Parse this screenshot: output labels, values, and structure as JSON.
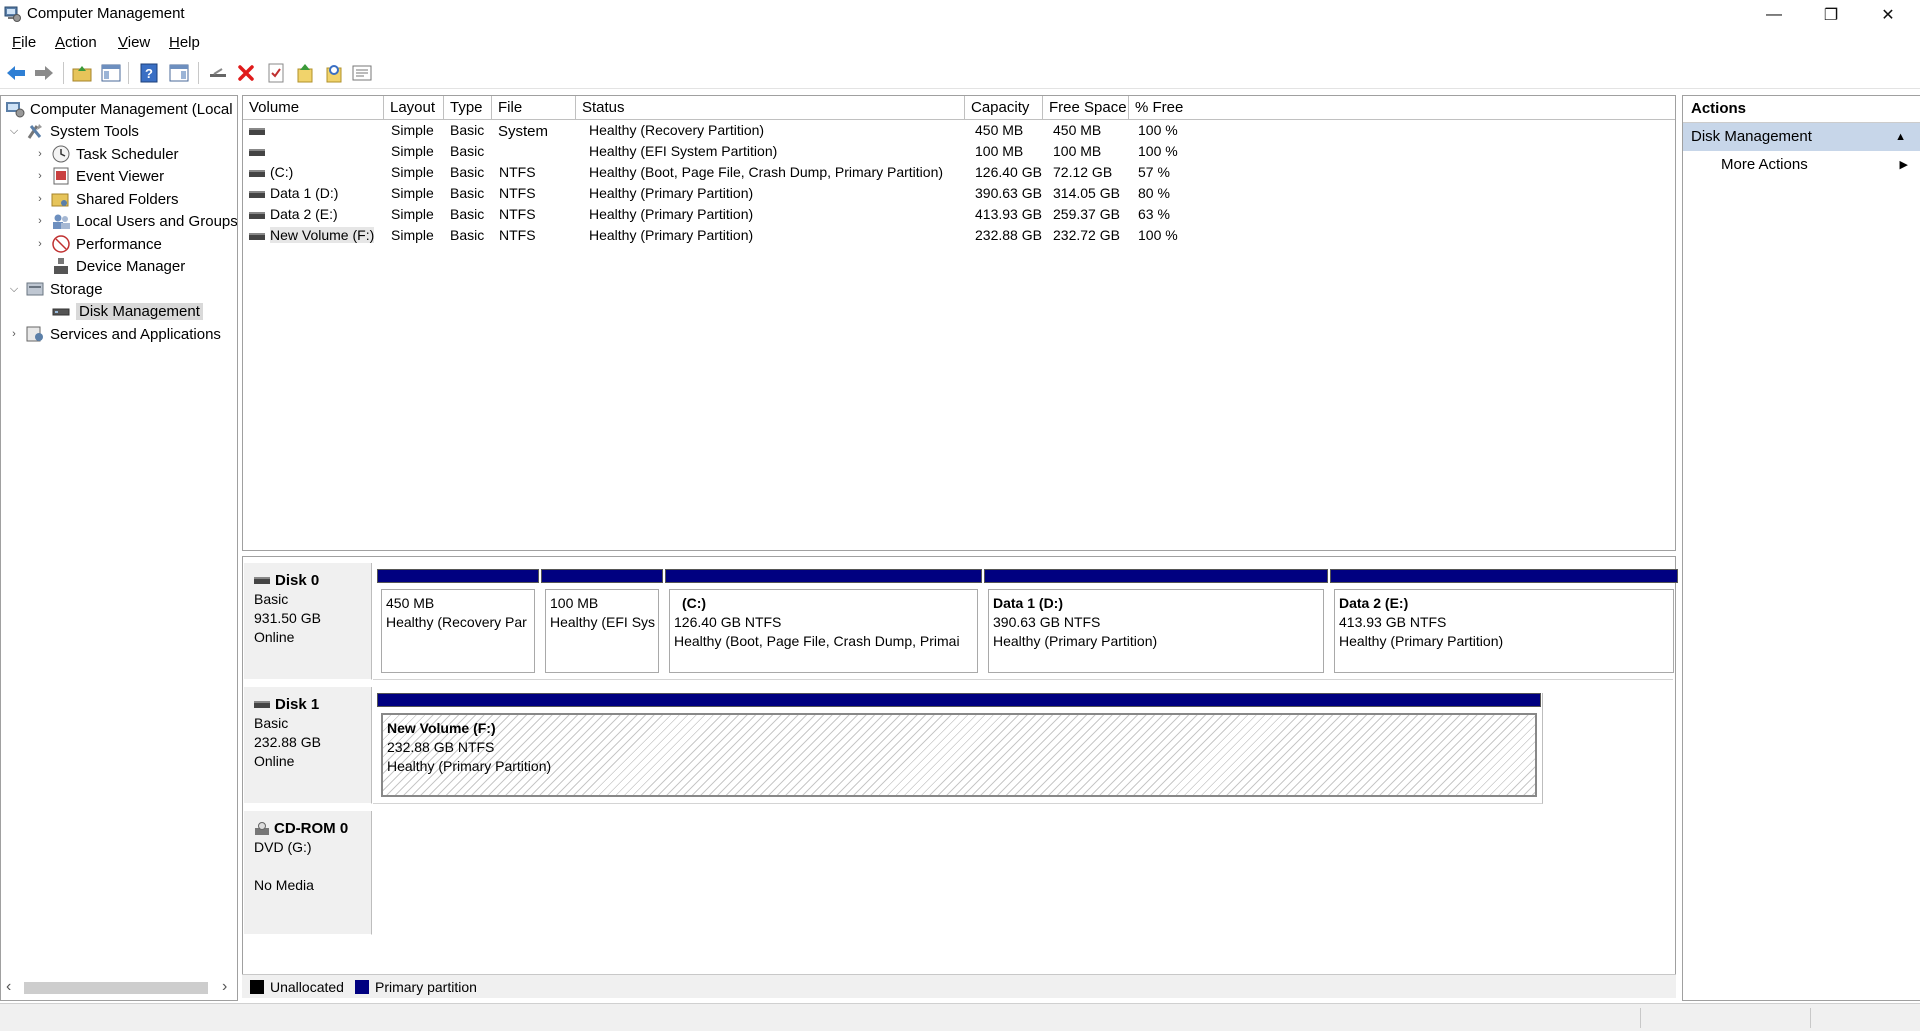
{
  "window": {
    "title": "Computer Management",
    "buttons": {
      "minimize": "—",
      "restore": "❐",
      "close": "✕"
    }
  },
  "menu": [
    "File",
    "Action",
    "View",
    "Help"
  ],
  "toolbar": {
    "icons": [
      "back-icon",
      "forward-icon",
      "up-icon",
      "show-hide-tree-icon",
      "help-icon",
      "properties-pane-icon",
      "connect-icon",
      "delete-icon",
      "check-icon",
      "refresh-icon",
      "search-icon",
      "list-icon"
    ],
    "delete_color": "#e01b1b"
  },
  "tree": {
    "root": "Computer Management (Local",
    "system_tools": "System Tools",
    "task_scheduler": "Task Scheduler",
    "event_viewer": "Event Viewer",
    "shared_folders": "Shared Folders",
    "local_users": "Local Users and Groups",
    "performance": "Performance",
    "device_manager": "Device Manager",
    "storage": "Storage",
    "disk_management": "Disk Management",
    "services": "Services and Applications"
  },
  "volumes": {
    "columns": [
      "Volume",
      "Layout",
      "Type",
      "File System",
      "Status",
      "Capacity",
      "Free Space",
      "% Free"
    ],
    "rows": [
      {
        "volume": "",
        "layout": "Simple",
        "type": "Basic",
        "fs": "",
        "status": "Healthy (Recovery Partition)",
        "capacity": "450 MB",
        "free": "450 MB",
        "pct": "100 %"
      },
      {
        "volume": "",
        "layout": "Simple",
        "type": "Basic",
        "fs": "",
        "status": "Healthy (EFI System Partition)",
        "capacity": "100 MB",
        "free": "100 MB",
        "pct": "100 %"
      },
      {
        "volume": "(C:)",
        "layout": "Simple",
        "type": "Basic",
        "fs": "NTFS",
        "status": "Healthy (Boot, Page File, Crash Dump, Primary Partition)",
        "capacity": "126.40 GB",
        "free": "72.12 GB",
        "pct": "57 %"
      },
      {
        "volume": "Data 1 (D:)",
        "layout": "Simple",
        "type": "Basic",
        "fs": "NTFS",
        "status": "Healthy (Primary Partition)",
        "capacity": "390.63 GB",
        "free": "314.05 GB",
        "pct": "80 %"
      },
      {
        "volume": "Data 2 (E:)",
        "layout": "Simple",
        "type": "Basic",
        "fs": "NTFS",
        "status": "Healthy (Primary Partition)",
        "capacity": "413.93 GB",
        "free": "259.37 GB",
        "pct": "63 %"
      },
      {
        "volume": "New Volume (F:)",
        "layout": "Simple",
        "type": "Basic",
        "fs": "NTFS",
        "status": "Healthy (Primary Partition)",
        "capacity": "232.88 GB",
        "free": "232.72 GB",
        "pct": "100 %"
      }
    ]
  },
  "disks": {
    "disk0": {
      "name": "Disk 0",
      "type": "Basic",
      "size": "931.50 GB",
      "state": "Online",
      "parts": [
        {
          "title": "",
          "size": "450 MB",
          "status": "Healthy (Recovery Par"
        },
        {
          "title": "",
          "size": "100 MB",
          "status": "Healthy (EFI Sys"
        },
        {
          "title": "(C:)",
          "size": "126.40 GB NTFS",
          "status": "Healthy (Boot, Page File, Crash Dump, Primai"
        },
        {
          "title": "Data 1  (D:)",
          "size": "390.63 GB NTFS",
          "status": "Healthy (Primary Partition)"
        },
        {
          "title": "Data 2  (E:)",
          "size": "413.93 GB NTFS",
          "status": "Healthy (Primary Partition)"
        }
      ]
    },
    "disk1": {
      "name": "Disk 1",
      "type": "Basic",
      "size": "232.88 GB",
      "state": "Online",
      "parts": [
        {
          "title": "New Volume  (F:)",
          "size": "232.88 GB NTFS",
          "status": "Healthy (Primary Partition)"
        }
      ]
    },
    "cdrom0": {
      "name": "CD-ROM 0",
      "type": "DVD (G:)",
      "state": "No Media"
    }
  },
  "legend": {
    "unallocated": "Unallocated",
    "unallocated_color": "#000000",
    "primary": "Primary partition",
    "primary_color": "#000080"
  },
  "actions": {
    "header": "Actions",
    "section": "Disk Management",
    "more": "More Actions"
  }
}
